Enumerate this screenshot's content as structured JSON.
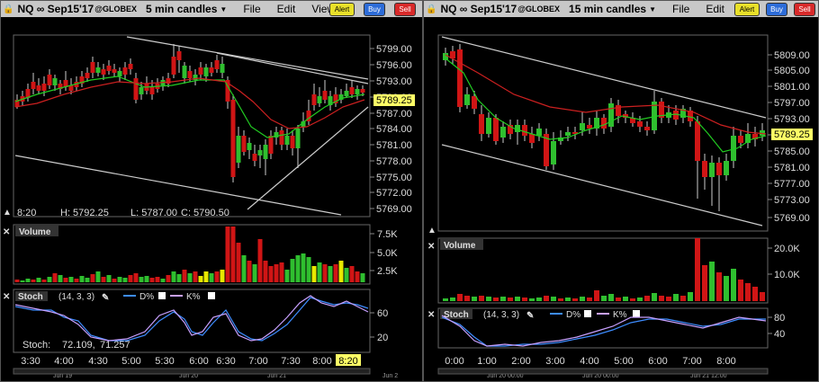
{
  "windows": [
    {
      "symbol": "NQ ∞ Sep15'17",
      "exchange": "@GLOBEX",
      "timeframe": "5 min candles",
      "menu": [
        "File",
        "Edit",
        "View"
      ],
      "alert_label": "Alert",
      "buy_label": "Buy",
      "sell_label": "Sell",
      "price_ticks": [
        "5799.00",
        "5796.00",
        "5793.00",
        "5790.00",
        "5787.00",
        "5784.00",
        "5781.00",
        "5778.00",
        "5775.00",
        "5772.00",
        "5769.00"
      ],
      "last_price": "5789.25",
      "bar_info": {
        "time": "8:20",
        "high": "H: 5792.25",
        "low": "L: 5787.00",
        "close": "C: 5790.50"
      },
      "volume_label": "Volume",
      "volume_ticks": [
        "7.5K",
        "5.0K",
        "2.5K"
      ],
      "stoch_label": "Stoch",
      "stoch_params": "(14, 3, 3)",
      "d_label": "D%",
      "k_label": "K%",
      "stoch_ticks": [
        "60",
        "20"
      ],
      "stoch_readout": {
        "label": "Stoch:",
        "v1": "72.109",
        "v2": "71.257"
      },
      "time_ticks": [
        "3:30",
        "4:00",
        "4:30",
        "5:00",
        "5:30",
        "6:00",
        "6:30",
        "7:00",
        "7:30",
        "8:00"
      ],
      "time_current": "8:20",
      "date_labels": [
        "Jun 19",
        "Jun 20",
        "Jun 21",
        "Jun 2"
      ]
    },
    {
      "symbol": "NQ ∞ Sep15'17",
      "exchange": "@GLOBEX",
      "timeframe": "15 min candles",
      "menu": [
        "File",
        "Edit"
      ],
      "alert_label": "Alert",
      "buy_label": "Buy",
      "sell_label": "Sell",
      "price_ticks": [
        "5809.00",
        "5805.00",
        "5801.00",
        "5797.00",
        "5793.00",
        "5789.00",
        "5785.00",
        "5781.00",
        "5777.00",
        "5773.00",
        "5769.00"
      ],
      "last_price": "5789.25",
      "volume_label": "Volume",
      "volume_ticks": [
        "20.0K",
        "10.0K"
      ],
      "stoch_label": "Stoch",
      "stoch_params": "(14, 3, 3)",
      "d_label": "D%",
      "k_label": "K%",
      "stoch_ticks": [
        "80",
        "40"
      ],
      "time_ticks": [
        "0:00",
        "1:00",
        "2:00",
        "3:00",
        "4:00",
        "5:00",
        "6:00",
        "7:00",
        "8:00"
      ],
      "date_labels": [
        "Jun 20 00:00",
        "Jun 20 00:00",
        "Jun 21 12:00"
      ]
    }
  ],
  "colors": {
    "up": "#2fbf2f",
    "down": "#d01515",
    "ma_fast": "#22cc22",
    "ma_slow": "#cc2020",
    "d_line": "#3d8cff",
    "k_line": "#c8a0ff",
    "vol_hl": "#e8e800"
  }
}
